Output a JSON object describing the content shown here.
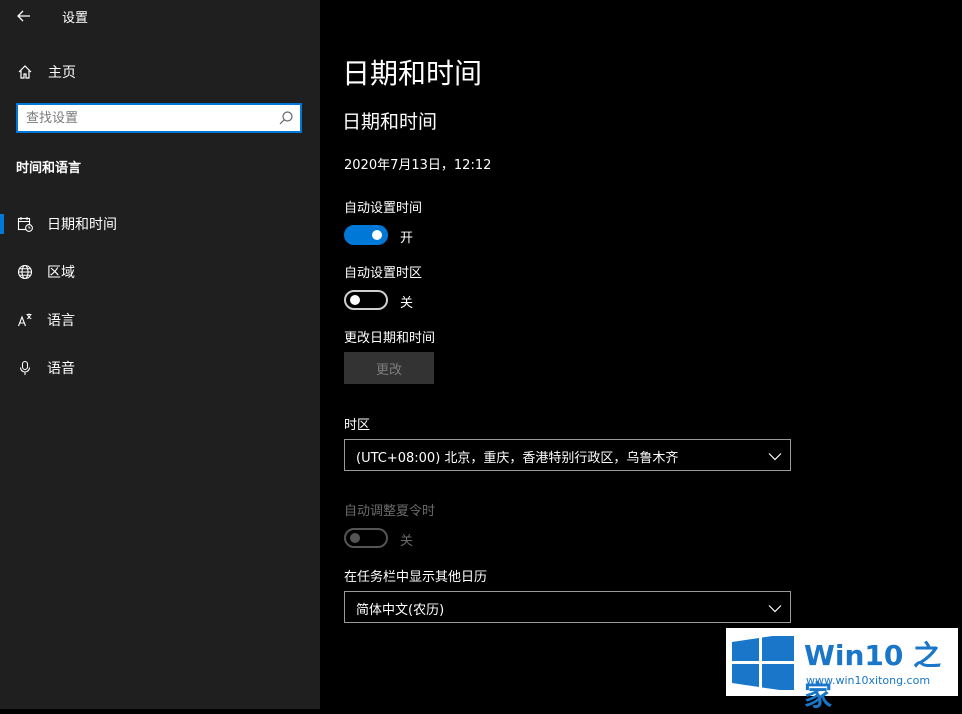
{
  "app": {
    "title": "设置"
  },
  "sidebar": {
    "home_label": "主页",
    "search_placeholder": "查找设置",
    "section_title": "时间和语言",
    "items": [
      {
        "label": "日期和时间",
        "icon": "calendar-clock-icon",
        "active": true
      },
      {
        "label": "区域",
        "icon": "globe-icon",
        "active": false
      },
      {
        "label": "语言",
        "icon": "language-icon",
        "active": false
      },
      {
        "label": "语音",
        "icon": "microphone-icon",
        "active": false
      }
    ]
  },
  "main": {
    "page_title": "日期和时间",
    "section_title": "日期和时间",
    "current_datetime": "2020年7月13日，12:12",
    "auto_time": {
      "label": "自动设置时间",
      "state": "开",
      "on": true
    },
    "auto_timezone": {
      "label": "自动设置时区",
      "state": "关",
      "on": false
    },
    "change": {
      "label": "更改日期和时间",
      "button": "更改"
    },
    "timezone": {
      "label": "时区",
      "value": "(UTC+08:00) 北京，重庆，香港特别行政区，乌鲁木齐"
    },
    "dst": {
      "label": "自动调整夏令时",
      "state": "关",
      "enabled": false
    },
    "calendar": {
      "label": "在任务栏中显示其他日历",
      "value": "简体中文(农历)"
    }
  },
  "watermark": {
    "title": "Win10 之家",
    "url": "www.win10xitong.com"
  },
  "colors": {
    "accent": "#0078d7",
    "sidebar_bg": "#1f1f1f",
    "main_bg": "#000000",
    "watermark_blue": "#1976c9"
  }
}
